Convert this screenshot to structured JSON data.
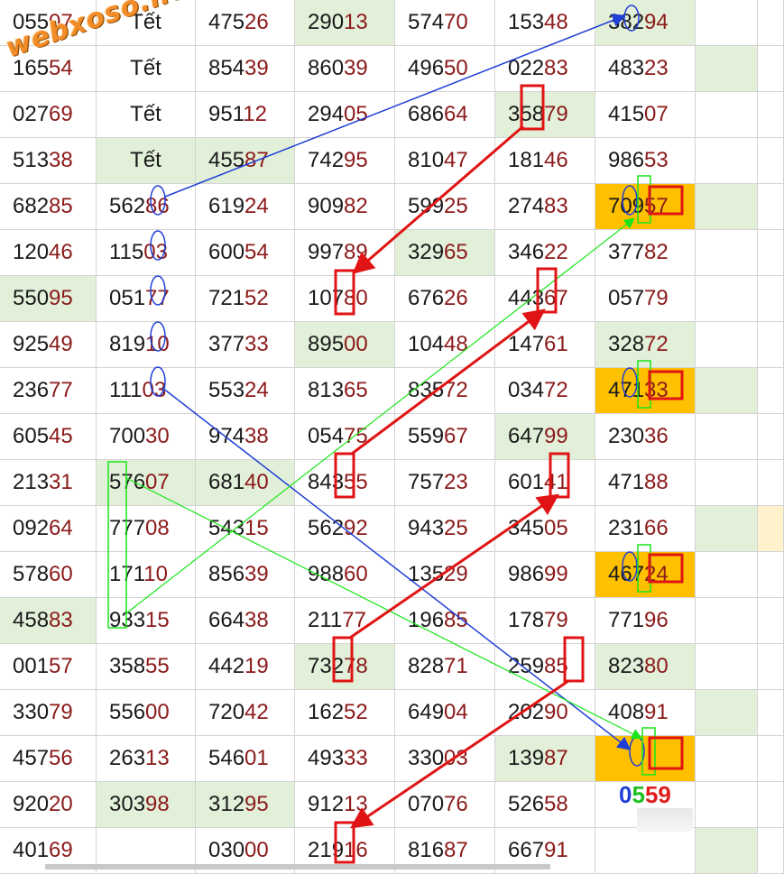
{
  "brand": {
    "watermark": "webxoso.net"
  },
  "colors": {
    "digit": "#1a1a1a",
    "tail": "#8b1a1a",
    "green_cell": "#e2f0d9",
    "orange_cell": "#ffc000",
    "blue_mark": "#1f3fd6",
    "green_mark": "#19e619",
    "red_mark": "#e01414"
  },
  "table": {
    "rows": [
      [
        "05507",
        "Tết",
        "47526",
        "29013",
        "57470",
        "15348",
        "38294"
      ],
      [
        "16554",
        "Tết",
        "85439",
        "86039",
        "49650",
        "02283",
        "48323"
      ],
      [
        "02769",
        "Tết",
        "95112",
        "29405",
        "68664",
        "35879",
        "41507"
      ],
      [
        "51338",
        "Tết",
        "45587",
        "74295",
        "81047",
        "18146",
        "98653"
      ],
      [
        "68285",
        "56286",
        "61924",
        "90982",
        "59925",
        "27483",
        "70957"
      ],
      [
        "12046",
        "11503",
        "60054",
        "99789",
        "32965",
        "34622",
        "37782"
      ],
      [
        "55095",
        "05177",
        "72152",
        "10780",
        "67626",
        "44367",
        "05779"
      ],
      [
        "92549",
        "81910",
        "37733",
        "89500",
        "10448",
        "14761",
        "32872"
      ],
      [
        "23677",
        "11103",
        "55324",
        "81365",
        "83572",
        "03472",
        "47133"
      ],
      [
        "60545",
        "70030",
        "97438",
        "05475",
        "55967",
        "64799",
        "23036"
      ],
      [
        "21331",
        "57607",
        "68140",
        "84355",
        "75723",
        "60141",
        "47188"
      ],
      [
        "09264",
        "77708",
        "54315",
        "56292",
        "94325",
        "34505",
        "23166"
      ],
      [
        "57860",
        "17110",
        "85639",
        "98860",
        "13529",
        "98699",
        "46724"
      ],
      [
        "45883",
        "93315",
        "66438",
        "21177",
        "19685",
        "17879",
        "77196"
      ],
      [
        "00157",
        "35855",
        "44219",
        "73278",
        "82871",
        "25985",
        "82380"
      ],
      [
        "33079",
        "55600",
        "72042",
        "16252",
        "64904",
        "20290",
        "40891"
      ],
      [
        "45756",
        "26313",
        "54601",
        "49333",
        "33003",
        "13987",
        ""
      ],
      [
        "92020",
        "30398",
        "31295",
        "91213",
        "07076",
        "52658",
        ""
      ],
      [
        "40169",
        "",
        "03000",
        "21916",
        "81687",
        "66791",
        ""
      ]
    ],
    "green_cells": [
      [
        0,
        3
      ],
      [
        0,
        6
      ],
      [
        1,
        7
      ],
      [
        2,
        5
      ],
      [
        3,
        1
      ],
      [
        3,
        2
      ],
      [
        4,
        7
      ],
      [
        5,
        4
      ],
      [
        6,
        0
      ],
      [
        7,
        3
      ],
      [
        7,
        6
      ],
      [
        8,
        7
      ],
      [
        9,
        5
      ],
      [
        10,
        1
      ],
      [
        10,
        2
      ],
      [
        11,
        7
      ],
      [
        13,
        0
      ],
      [
        14,
        3
      ],
      [
        14,
        6
      ],
      [
        15,
        7
      ],
      [
        16,
        5
      ],
      [
        17,
        1
      ],
      [
        17,
        2
      ],
      [
        18,
        7
      ]
    ],
    "orange_cells": [
      [
        4,
        6
      ],
      [
        8,
        6
      ],
      [
        12,
        6
      ],
      [
        16,
        6
      ]
    ],
    "yellow_cells": [
      [
        11,
        8
      ]
    ]
  },
  "prediction": {
    "digits": [
      "0",
      "5",
      "59"
    ]
  }
}
